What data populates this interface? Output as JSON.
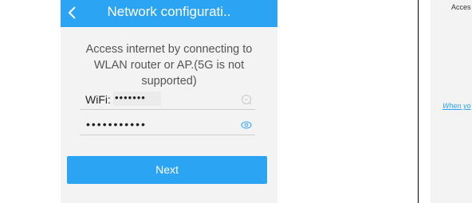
{
  "header": {
    "title": "Network configurati.."
  },
  "description": "Access internet by connecting to WLAN router or AP.(5G is not supported)",
  "wifi_field": {
    "label": "WiFi:",
    "value": "•••••••"
  },
  "password_field": {
    "value": "•••••••••••"
  },
  "next_button": {
    "label": "Next"
  },
  "right_panel": {
    "top_text": "Acces",
    "link_text": "When yo"
  },
  "colors": {
    "accent": "#2ba4f3",
    "background": "#f3f3f3"
  },
  "icons": {
    "back": "chevron-left-icon",
    "wifi_clear": "clear-circle-icon",
    "password_toggle": "eye-icon"
  }
}
